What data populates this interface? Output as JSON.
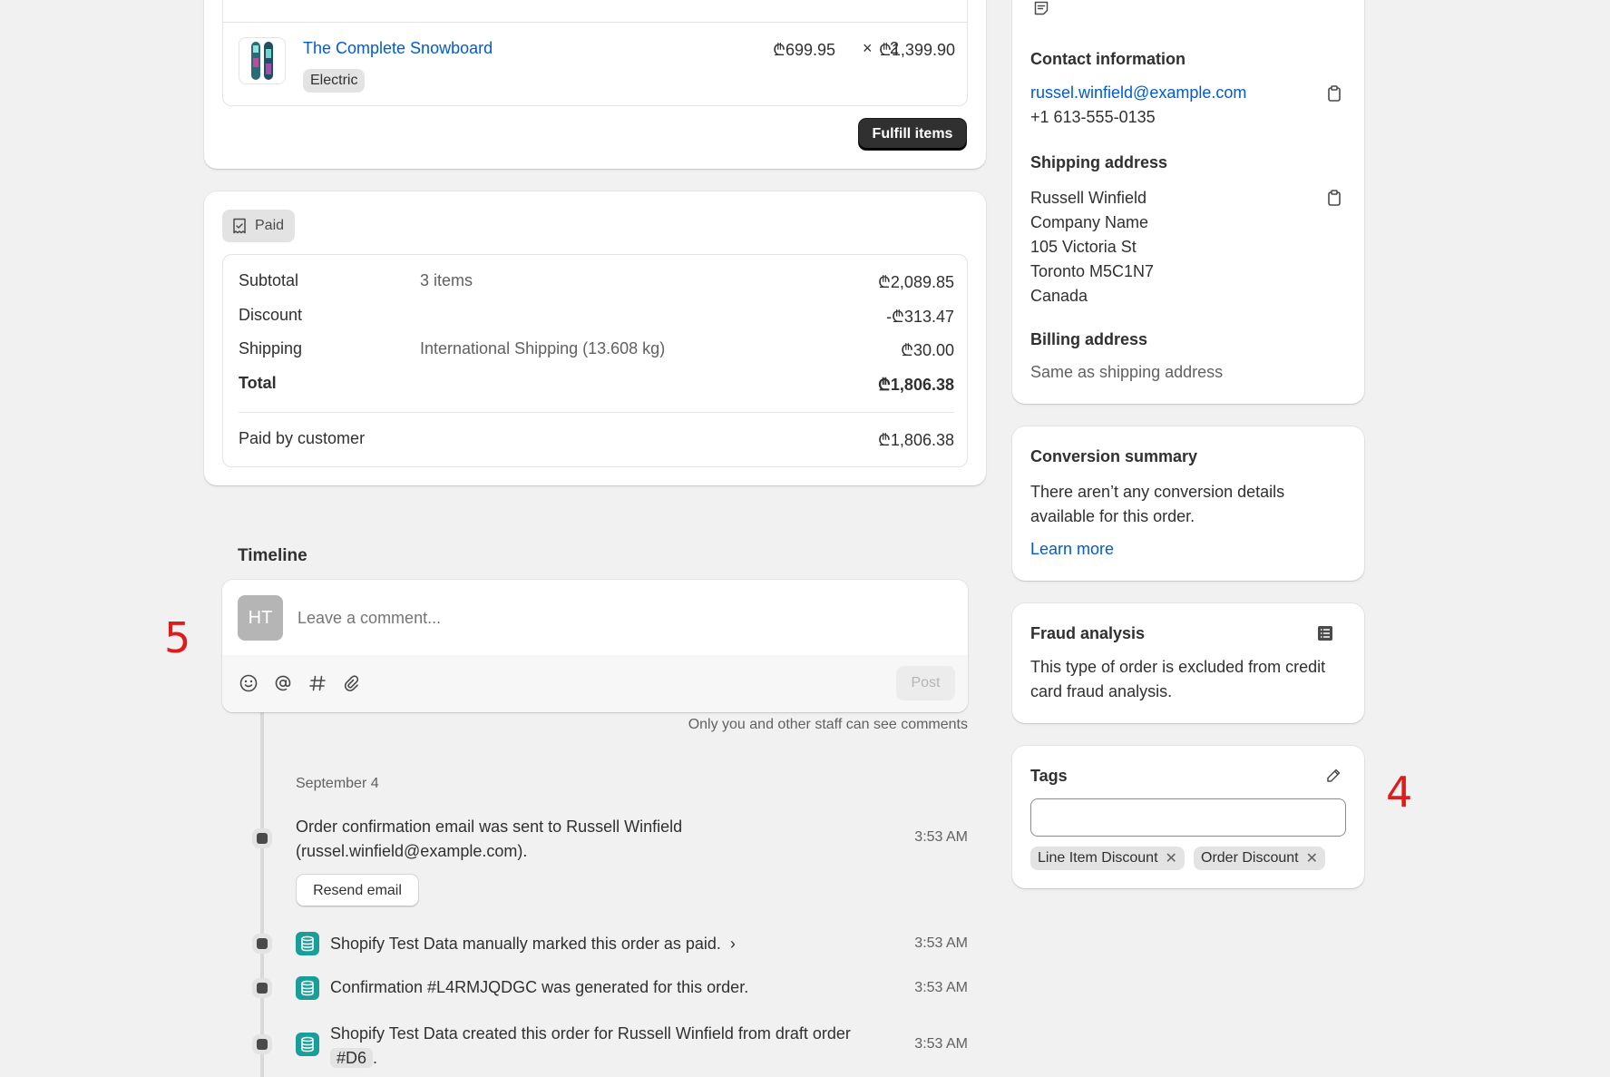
{
  "line_item": {
    "name": "The Complete Snowboard",
    "variant": "Electric",
    "unit_price": "₾699.95",
    "times": "×",
    "quantity": "2",
    "line_total": "₾1,399.90"
  },
  "fulfill_button": "Fulfill items",
  "payment": {
    "status": "Paid",
    "rows": [
      {
        "label": "Subtotal",
        "detail": "3 items",
        "amount": "₾2,089.85"
      },
      {
        "label": "Discount",
        "detail": "",
        "amount": "-₾313.47"
      },
      {
        "label": "Shipping",
        "detail": "International Shipping (13.608 kg)",
        "amount": "₾30.00"
      },
      {
        "label": "Total",
        "detail": "",
        "amount": "₾1,806.38"
      }
    ],
    "paid_by_label": "Paid by customer",
    "paid_by_amount": "₾1,806.38"
  },
  "timeline": {
    "title": "Timeline",
    "avatar_initials": "HT",
    "comment_placeholder": "Leave a comment...",
    "post_label": "Post",
    "staff_note": "Only you and other staff can see comments",
    "date_label": "September 4",
    "events": [
      {
        "text": "Order confirmation email was sent to Russell Winfield (russel.winfield@example.com).",
        "time": "3:53 AM",
        "button": "Resend email"
      },
      {
        "text": "Shopify Test Data manually marked this order as paid.",
        "time": "3:53 AM"
      },
      {
        "text": "Confirmation #L4RMJQDGC was generated for this order.",
        "time": "3:53 AM"
      },
      {
        "text": "Shopify Test Data created this order for Russell Winfield from draft order",
        "code": "#D6",
        "suffix": ".",
        "time": "3:53 AM"
      }
    ]
  },
  "customer": {
    "contact_heading": "Contact information",
    "email": "russel.winfield@example.com",
    "phone": "+1 613-555-0135",
    "shipping_heading": "Shipping address",
    "shipping_lines": [
      "Russell Winfield",
      "Company Name",
      "105 Victoria St",
      "Toronto M5C1N7",
      "Canada"
    ],
    "billing_heading": "Billing address",
    "billing_text": "Same as shipping address"
  },
  "conversion": {
    "heading": "Conversion summary",
    "text": "There aren’t any conversion details available for this order.",
    "link": "Learn more"
  },
  "fraud": {
    "heading": "Fraud analysis",
    "text": "This type of order is excluded from credit card fraud analysis."
  },
  "tags": {
    "heading": "Tags",
    "input_value": "",
    "items": [
      "Line Item Discount",
      "Order Discount"
    ]
  },
  "annotations": {
    "left": "5",
    "right": "4"
  },
  "colors": {
    "link": "#005bd3",
    "accent_teal": "#1a9e9a",
    "annotation": "#e01b1b"
  }
}
